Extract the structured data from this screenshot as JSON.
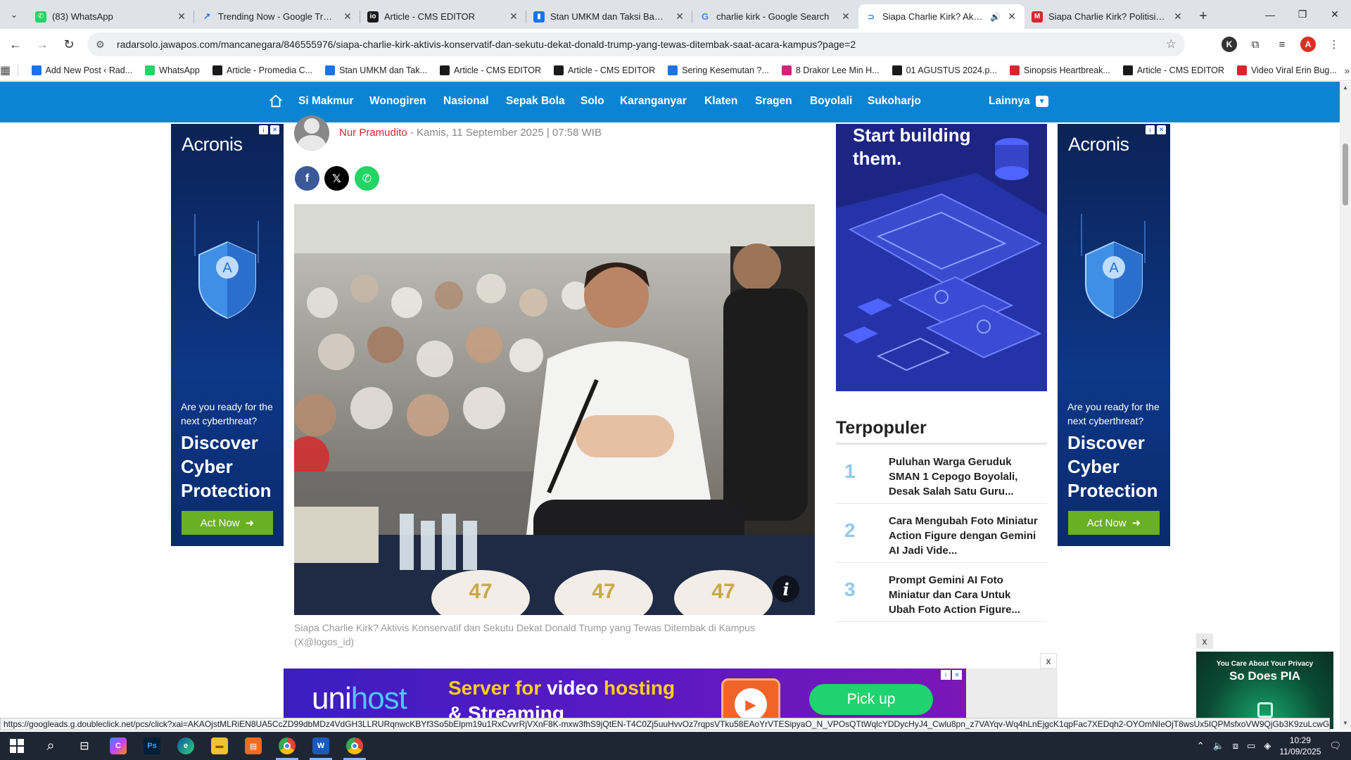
{
  "browser": {
    "tabs": [
      {
        "title": "(83) WhatsApp",
        "fav": "whatsapp-icon",
        "color": "#25d366"
      },
      {
        "title": "Trending Now - Google Trends",
        "fav": "trends-icon",
        "color": "#1a73e8"
      },
      {
        "title": "Article - CMS EDITOR",
        "fav": "cms-icon",
        "color": "#1a1a1a"
      },
      {
        "title": "Stan UMKM dan Taksi Bandara",
        "fav": "bookmark-icon",
        "color": "#1a73e8"
      },
      {
        "title": "charlie kirk - Google Search",
        "fav": "google-icon",
        "color": "#ffffff"
      },
      {
        "title": "Siapa Charlie Kirk? Aktivis K",
        "fav": "jawapos-icon",
        "color": "#0b85d3",
        "active": true
      },
      {
        "title": "Siapa Charlie Kirk? Politisi AS M",
        "fav": "news-icon",
        "color": "#d9262e"
      }
    ],
    "url": "radarsolo.jawapos.com/mancanegara/846555976/siapa-charlie-kirk-aktivis-konservatif-dan-sekutu-dekat-donald-trump-yang-tewas-ditembak-saat-acara-kampus?page=2",
    "profile_initial": "A",
    "extension_initial": "K"
  },
  "bookmarks": [
    {
      "label": "Add New Post ‹ Rad...",
      "color": "#1a73e8"
    },
    {
      "label": "WhatsApp",
      "color": "#25d366"
    },
    {
      "label": "Article - Promedia C...",
      "color": "#1a1a1a"
    },
    {
      "label": "Stan UMKM dan Tak...",
      "color": "#1a73e8"
    },
    {
      "label": "Article - CMS EDITOR",
      "color": "#1a1a1a"
    },
    {
      "label": "Article - CMS EDITOR",
      "color": "#1a1a1a"
    },
    {
      "label": "Sering Kesemutan ?...",
      "color": "#1a73e8"
    },
    {
      "label": "8 Drakor Lee Min H...",
      "color": "#d0247a"
    },
    {
      "label": "01 AGUSTUS 2024.p...",
      "color": "#1a1a1a"
    },
    {
      "label": "Sinopsis Heartbreak...",
      "color": "#d9262e"
    },
    {
      "label": "Article - CMS EDITOR",
      "color": "#1a1a1a"
    },
    {
      "label": "Video Viral Erin Bug...",
      "color": "#d9262e"
    }
  ],
  "sitenav": {
    "items": [
      "Si Makmur",
      "Wonogiren",
      "Nasional",
      "Sepak Bola",
      "Solo",
      "Karanganyar",
      "Klaten",
      "Sragen",
      "Boyolali",
      "Sukoharjo"
    ],
    "more": "Lainnya"
  },
  "article": {
    "author": "Nur Pramudito",
    "date": " - Kamis, 11 September 2025 | 07:58 WIB",
    "caption": "Siapa Charlie Kirk? Aktivis Konservatif dan Sekutu Dekat Donald Trump yang Tewas Ditembak di Kampus (X@logos_id)"
  },
  "ads": {
    "acronis_brand": "Acronis",
    "acronis_question": "Are you ready for the next cyberthreat?",
    "acronis_headline": "Discover Cyber Protection",
    "acronis_cta": "Act Now",
    "right_ad_text": "Start building them.",
    "unihost_logo_a": "uni",
    "unihost_logo_b": "host",
    "unihost_pitch_1": "Server for ",
    "unihost_pitch_2": "video",
    "unihost_pitch_3": " hosting",
    "unihost_pitch_4": "& Streaming",
    "unihost_cta": "Pick up",
    "pia_small": "You Care About Your Privacy",
    "pia_big": "So Does PIA",
    "close": "x"
  },
  "terpopuler": {
    "heading": "Terpopuler",
    "items": [
      {
        "num": "1",
        "title": "Puluhan Warga Geruduk SMAN 1 Cepogo Boyolali, Desak Salah Satu Guru..."
      },
      {
        "num": "2",
        "title": "Cara Mengubah Foto Miniatur Action Figure dengan Gemini AI Jadi Vide..."
      },
      {
        "num": "3",
        "title": "Prompt Gemini AI Foto Miniatur dan Cara Untuk Ubah Foto Action Figure..."
      }
    ]
  },
  "status_url": "https://googleads.g.doubleclick.net/pcs/click?xai=AKAOjstMLRiEN8UA5CcZD99dbMDz4VdGH3LLRURqnwcKBYf3So5bElpm19u1RxCvvrRjVXnF8K-mxw3fhS9jQtEN-T4C0Zj5uuHvvOz7rqpsVTku58EAoYrVTESipyaO_N_VPOsQTtWqlcYDDycHyJ4_Cwlu8pn_z7VAYqv-Wq4hLnEjgcK1qpFac7XEDqh2-OYOmNIeOjT8wsUx5IQPMsfxoVW9QjGb3K9zuLcwGwQYXmUIEC...",
  "taskbar": {
    "time": "10:29",
    "date": "11/09/2025"
  }
}
